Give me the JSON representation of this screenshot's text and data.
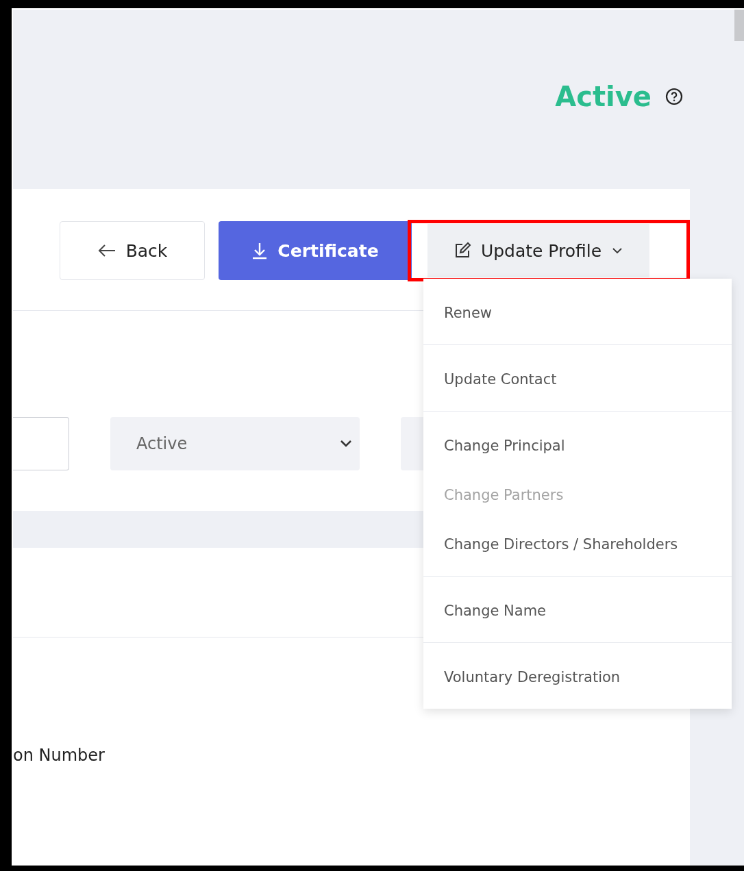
{
  "status": {
    "label": "Active"
  },
  "toolbar": {
    "buttons": [
      {
        "kind": "back",
        "label": "Back"
      },
      {
        "kind": "primary",
        "label": "Certificate"
      },
      {
        "kind": "dropdown",
        "label": "Update Profile",
        "expanded": true,
        "highlighted": true
      }
    ]
  },
  "filters": {
    "status_select": {
      "value": "Active"
    }
  },
  "dropdown_menu": {
    "groups": [
      {
        "items": [
          {
            "label": "Renew",
            "disabled": false
          }
        ]
      },
      {
        "items": [
          {
            "label": "Update Contact",
            "disabled": false
          }
        ]
      },
      {
        "items": [
          {
            "label": "Change Principal",
            "disabled": false
          },
          {
            "label": "Change Partners",
            "disabled": true
          },
          {
            "label": "Change Directors / Shareholders",
            "disabled": false
          }
        ]
      },
      {
        "items": [
          {
            "label": "Change Name",
            "disabled": false
          }
        ]
      },
      {
        "items": [
          {
            "label": "Voluntary Deregistration",
            "disabled": false
          }
        ]
      }
    ]
  },
  "details": {
    "field_label": "on Number"
  }
}
